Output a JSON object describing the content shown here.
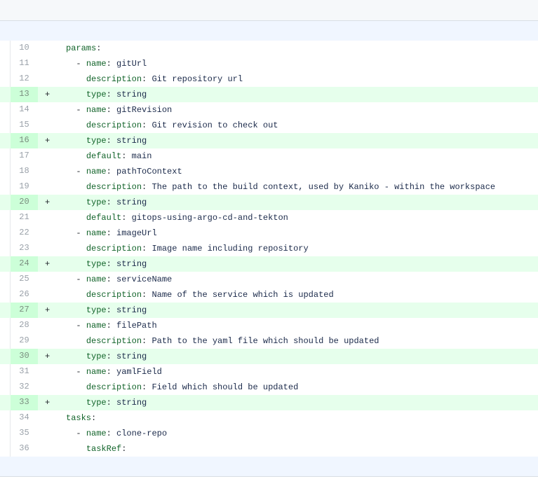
{
  "diff": {
    "lines": [
      {
        "num": "10",
        "added": false,
        "marker": "",
        "indent": "",
        "dash": "",
        "key": "params",
        "value": ""
      },
      {
        "num": "11",
        "added": false,
        "marker": "",
        "indent": "  ",
        "dash": "- ",
        "key": "name",
        "value": "gitUrl"
      },
      {
        "num": "12",
        "added": false,
        "marker": "",
        "indent": "    ",
        "dash": "",
        "key": "description",
        "value": "Git repository url"
      },
      {
        "num": "13",
        "added": true,
        "marker": "+",
        "indent": "    ",
        "dash": "",
        "key": "type",
        "value": "string"
      },
      {
        "num": "14",
        "added": false,
        "marker": "",
        "indent": "  ",
        "dash": "- ",
        "key": "name",
        "value": "gitRevision"
      },
      {
        "num": "15",
        "added": false,
        "marker": "",
        "indent": "    ",
        "dash": "",
        "key": "description",
        "value": "Git revision to check out"
      },
      {
        "num": "16",
        "added": true,
        "marker": "+",
        "indent": "    ",
        "dash": "",
        "key": "type",
        "value": "string"
      },
      {
        "num": "17",
        "added": false,
        "marker": "",
        "indent": "    ",
        "dash": "",
        "key": "default",
        "value": "main"
      },
      {
        "num": "18",
        "added": false,
        "marker": "",
        "indent": "  ",
        "dash": "- ",
        "key": "name",
        "value": "pathToContext"
      },
      {
        "num": "19",
        "added": false,
        "marker": "",
        "indent": "    ",
        "dash": "",
        "key": "description",
        "value": "The path to the build context, used by Kaniko - within the workspace"
      },
      {
        "num": "20",
        "added": true,
        "marker": "+",
        "indent": "    ",
        "dash": "",
        "key": "type",
        "value": "string"
      },
      {
        "num": "21",
        "added": false,
        "marker": "",
        "indent": "    ",
        "dash": "",
        "key": "default",
        "value": "gitops-using-argo-cd-and-tekton"
      },
      {
        "num": "22",
        "added": false,
        "marker": "",
        "indent": "  ",
        "dash": "- ",
        "key": "name",
        "value": "imageUrl"
      },
      {
        "num": "23",
        "added": false,
        "marker": "",
        "indent": "    ",
        "dash": "",
        "key": "description",
        "value": "Image name including repository"
      },
      {
        "num": "24",
        "added": true,
        "marker": "+",
        "indent": "    ",
        "dash": "",
        "key": "type",
        "value": "string"
      },
      {
        "num": "25",
        "added": false,
        "marker": "",
        "indent": "  ",
        "dash": "- ",
        "key": "name",
        "value": "serviceName"
      },
      {
        "num": "26",
        "added": false,
        "marker": "",
        "indent": "    ",
        "dash": "",
        "key": "description",
        "value": "Name of the service which is updated"
      },
      {
        "num": "27",
        "added": true,
        "marker": "+",
        "indent": "    ",
        "dash": "",
        "key": "type",
        "value": "string"
      },
      {
        "num": "28",
        "added": false,
        "marker": "",
        "indent": "  ",
        "dash": "- ",
        "key": "name",
        "value": "filePath"
      },
      {
        "num": "29",
        "added": false,
        "marker": "",
        "indent": "    ",
        "dash": "",
        "key": "description",
        "value": "Path to the yaml file which should be updated"
      },
      {
        "num": "30",
        "added": true,
        "marker": "+",
        "indent": "    ",
        "dash": "",
        "key": "type",
        "value": "string"
      },
      {
        "num": "31",
        "added": false,
        "marker": "",
        "indent": "  ",
        "dash": "- ",
        "key": "name",
        "value": "yamlField"
      },
      {
        "num": "32",
        "added": false,
        "marker": "",
        "indent": "    ",
        "dash": "",
        "key": "description",
        "value": "Field which should be updated"
      },
      {
        "num": "33",
        "added": true,
        "marker": "+",
        "indent": "    ",
        "dash": "",
        "key": "type",
        "value": "string"
      },
      {
        "num": "34",
        "added": false,
        "marker": "",
        "indent": "",
        "dash": "",
        "key": "tasks",
        "value": ""
      },
      {
        "num": "35",
        "added": false,
        "marker": "",
        "indent": "  ",
        "dash": "- ",
        "key": "name",
        "value": "clone-repo"
      },
      {
        "num": "36",
        "added": false,
        "marker": "",
        "indent": "    ",
        "dash": "",
        "key": "taskRef",
        "value": ""
      }
    ]
  },
  "colors": {
    "added_row_bg": "#e6ffec",
    "added_gutter_bg": "#ccffd8",
    "hunk_bg": "#f0f6ff",
    "key_color": "#116329"
  }
}
